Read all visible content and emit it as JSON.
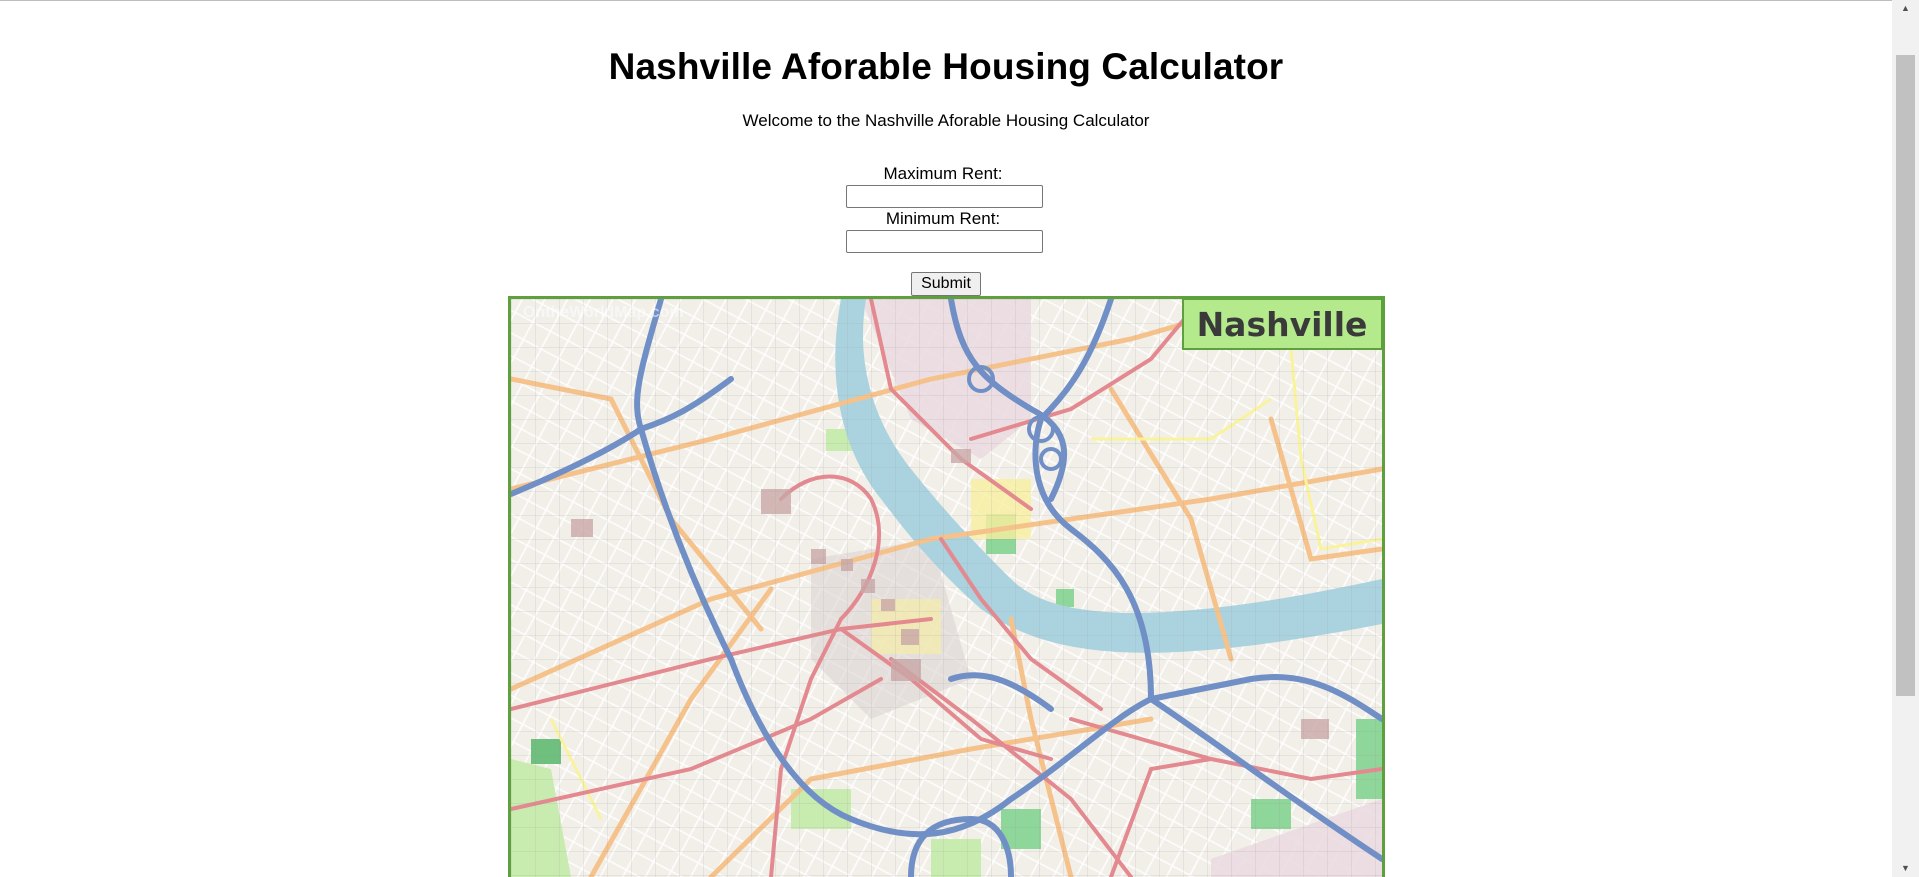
{
  "page": {
    "title": "Nashville Aforable Housing Calculator",
    "welcome": "Welcome to the Nashville Aforable Housing Calculator"
  },
  "form": {
    "max_rent_label": "Maximum Rent:",
    "max_rent_value": "",
    "min_rent_label": "Minimum Rent:",
    "min_rent_value": "",
    "submit_label": "Submit"
  },
  "map": {
    "badge": "Nashville",
    "watermark": "OntheWorldMap.com",
    "colors": {
      "land": "#f2efe9",
      "river": "#aad3df",
      "highway": "#6f8fc6",
      "arterial": "#e3898f",
      "secondary": "#f6c28b",
      "park": "#c8ebb0",
      "badge_bg": "#b4ea8c",
      "border": "#5e9f3e"
    }
  },
  "scrollbar": {
    "up_icon": "up-arrow-icon",
    "down_icon": "down-arrow-icon"
  }
}
